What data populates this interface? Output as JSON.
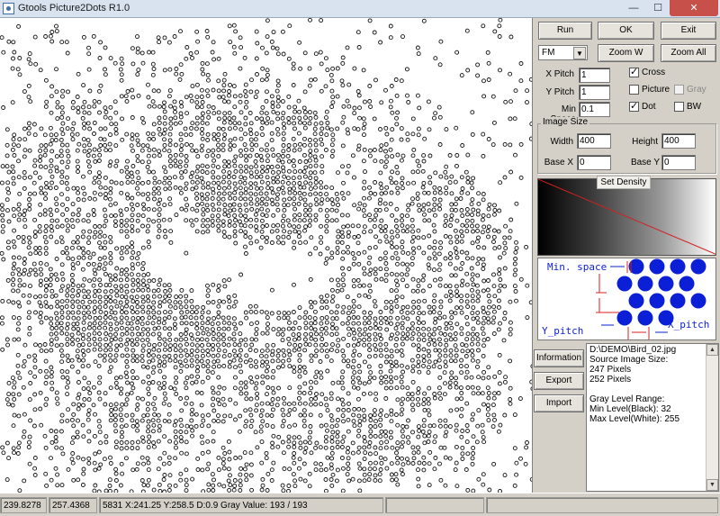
{
  "window": {
    "title": "Gtools Picture2Dots R1.0",
    "minimize_glyph": "—",
    "maximize_glyph": "☐",
    "close_glyph": "✕"
  },
  "toolbar": {
    "run_label": "Run",
    "ok_label": "OK",
    "exit_label": "Exit",
    "zoom_w_label": "Zoom W",
    "zoom_all_label": "Zoom All",
    "mode_select": {
      "value": "FM"
    }
  },
  "params": {
    "x_pitch_label": "X Pitch",
    "x_pitch_value": "1",
    "y_pitch_label": "Y Pitch",
    "y_pitch_value": "1",
    "min_space_label": "Min Space",
    "min_space_value": "0.1"
  },
  "options": {
    "cross": {
      "label": "Cross",
      "checked": true
    },
    "picture": {
      "label": "Picture",
      "checked": false
    },
    "gray": {
      "label": "Gray",
      "checked": false,
      "disabled": true
    },
    "dot": {
      "label": "Dot",
      "checked": true
    },
    "bw": {
      "label": "BW",
      "checked": false
    }
  },
  "image_size": {
    "group_label": "Image Size",
    "width_label": "Width",
    "width_value": "400",
    "height_label": "Height",
    "height_value": "400",
    "base_x_label": "Base X",
    "base_x_value": "0",
    "base_y_label": "Base Y",
    "base_y_value": "0"
  },
  "density": {
    "button_label": "Set Density",
    "line_color": "#d42020"
  },
  "diagram": {
    "min_space_label": "Min. space",
    "y_pitch_label": "Y_pitch",
    "x_pitch_label": "X_pitch",
    "label_color": "#0a1fd6",
    "dot_color": "#0a1fd6",
    "arrow_color": "#d42020"
  },
  "side_buttons": {
    "information_label": "Information",
    "export_label": "Export",
    "import_label": "Import"
  },
  "info_text": [
    "D:\\DEMO\\Bird_02.jpg",
    "Source Image Size:",
    "247 Pixels",
    "252 Pixels",
    "",
    "Gray Level Range:",
    "Min Level(Black): 32",
    "Max Level(White): 255"
  ],
  "status": {
    "x_value": "239.8278",
    "y_value": "257.4368",
    "summary": "5831 X:241.25 Y:258.5 D:0.9 Gray Value: 193 / 193"
  }
}
